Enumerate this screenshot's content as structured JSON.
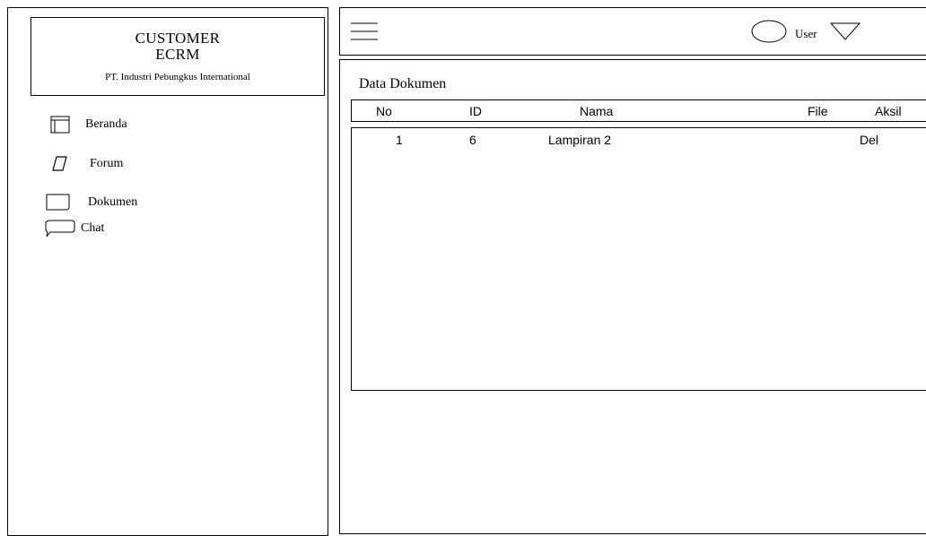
{
  "brand": {
    "title_line1": "CUSTOMER",
    "title_line2": "ECRM",
    "subtitle": "PT. Industri Pebungkus International"
  },
  "nav": {
    "items": [
      {
        "label": "Beranda",
        "icon": "home-window-icon"
      },
      {
        "label": "Forum",
        "icon": "forum-parallelogram-icon"
      },
      {
        "label": "Dokumen",
        "icon": "document-icon"
      },
      {
        "label": "Chat",
        "icon": "chat-bubble-icon"
      }
    ]
  },
  "topbar": {
    "menu_icon": "hamburger-menu-icon",
    "avatar_icon": "user-avatar-icon",
    "user_label": "User",
    "dropdown_icon": "triangle-down-icon"
  },
  "main": {
    "title": "Data Dokumen",
    "columns": [
      "No",
      "ID",
      "Nama",
      "File",
      "Aksil"
    ],
    "rows": [
      {
        "no": "1",
        "id": "6",
        "nama": "Lampiran 2",
        "file": "",
        "aksi": "Del"
      }
    ]
  }
}
